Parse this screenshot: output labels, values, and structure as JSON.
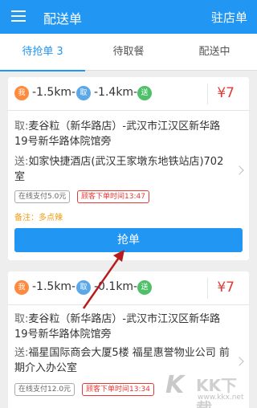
{
  "header": {
    "title": "配送单",
    "right_label": "驻店单",
    "menu_icon": "menu-icon"
  },
  "tabs": [
    {
      "label": "待抢单",
      "count": "3",
      "active": true
    },
    {
      "label": "待取餐",
      "active": false
    },
    {
      "label": "配送中",
      "active": false
    }
  ],
  "orders": [
    {
      "badge_wo": "我",
      "dist_shop": "-1.5km-",
      "badge_qu": "取",
      "dist_customer": "-1.4km-",
      "badge_song": "送",
      "price": "¥7",
      "pickup_label": "取:",
      "pickup_address": "麦谷粒（新华路店）-武汉市江汉区新华路19号新华路体院馆旁",
      "delivery_label": "送:",
      "delivery_address": "如家快捷酒店(武汉王家墩东地铁站店)702室",
      "payment": "在线支付5.0元",
      "order_time": "顾客下单时间13:47",
      "note": "备注：多点辣",
      "grab_label": "抢单"
    },
    {
      "badge_wo": "我",
      "dist_shop": "-1.5km-",
      "badge_qu": "取",
      "dist_customer": "-0.1km-",
      "badge_song": "送",
      "price": "¥7",
      "pickup_label": "取:",
      "pickup_address": "麦谷粒（新华路店）-武汉市江汉区新华路19号新华路体院馆旁",
      "delivery_label": "送:",
      "delivery_address": "福星国际商会大厦5楼 福星惠誉物业公司 前期介入办公室",
      "payment": "在线支付12.0元",
      "order_time": "顾客下单时间13:34"
    }
  ],
  "watermark": {
    "text": "KK下载",
    "url": "www.kkx.net"
  },
  "colors": {
    "accent": "#2196f3",
    "price": "#e53935",
    "note": "#f39c12"
  }
}
